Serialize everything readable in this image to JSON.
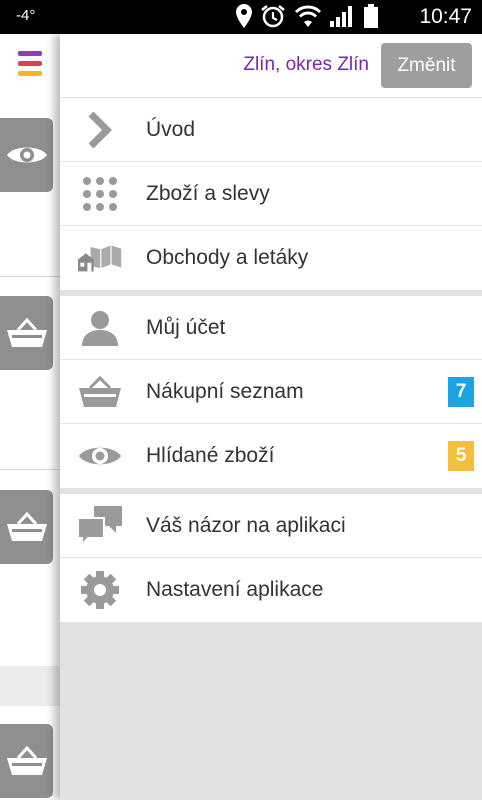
{
  "statusbar": {
    "temperature": "-4°",
    "time": "10:47"
  },
  "header": {
    "location": "Zlín, okres Zlín",
    "change_label": "Změnit"
  },
  "menu": {
    "group1": [
      {
        "label": "Úvod",
        "icon": "chevron-right-icon"
      },
      {
        "label": "Zboží a slevy",
        "icon": "grid-dots-icon"
      },
      {
        "label": "Obchody a letáky",
        "icon": "store-icon"
      }
    ],
    "group2": [
      {
        "label": "Můj účet",
        "icon": "user-icon"
      },
      {
        "label": "Nákupní seznam",
        "icon": "basket-icon",
        "badge": "7",
        "badge_color": "#1ba3e3"
      },
      {
        "label": "Hlídané zboží",
        "icon": "eye-icon",
        "badge": "5",
        "badge_color": "#f4bf3a"
      }
    ],
    "group3": [
      {
        "label": "Váš názor na aplikaci",
        "icon": "chat-bubbles-icon"
      },
      {
        "label": "Nastavení aplikace",
        "icon": "gear-icon"
      }
    ]
  },
  "colors": {
    "accent": "#7a27a6",
    "icon_gray": "#9a9a9a",
    "hamburger": [
      "#8e3bbf",
      "#e23c5a",
      "#f2b61f"
    ]
  }
}
